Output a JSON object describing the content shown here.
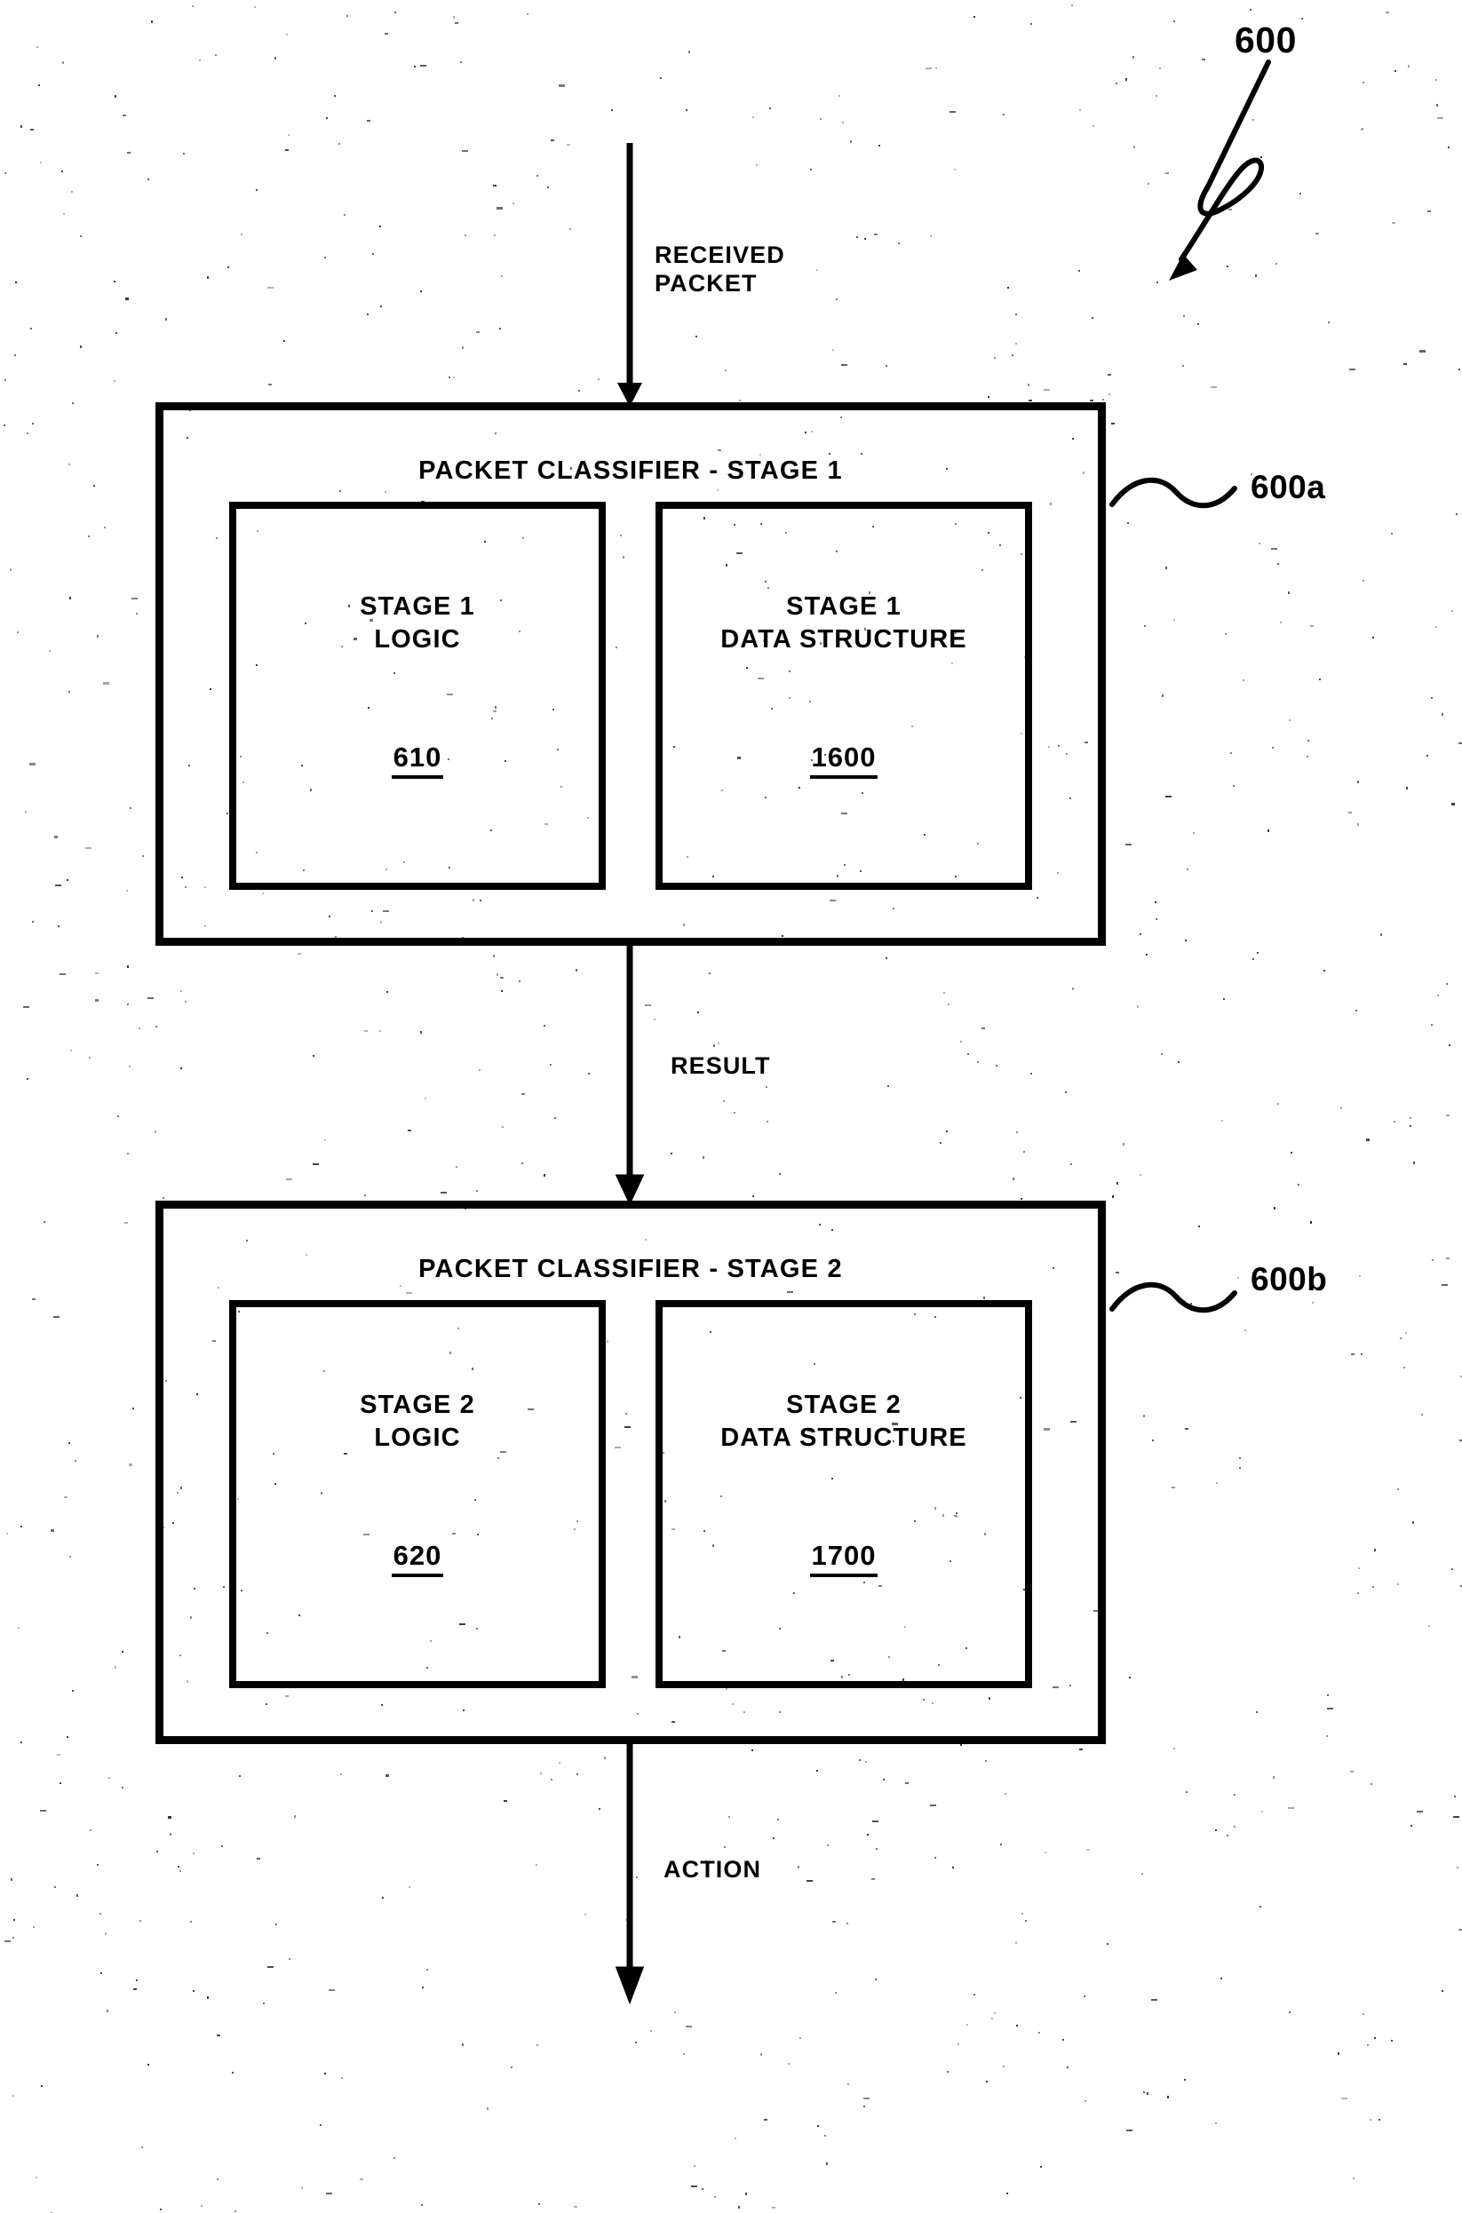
{
  "figure": {
    "reference_numeral": "600"
  },
  "flow": {
    "input_label": "RECEIVED\nPACKET",
    "middle_label": "RESULT",
    "output_label": "ACTION"
  },
  "stages": [
    {
      "title": "PACKET CLASSIFIER - STAGE 1",
      "side_reference": "600a",
      "blocks": [
        {
          "title": "STAGE 1\nLOGIC",
          "reference": "610"
        },
        {
          "title": "STAGE 1\nDATA STRUCTURE",
          "reference": "1600"
        }
      ]
    },
    {
      "title": "PACKET CLASSIFIER - STAGE 2",
      "side_reference": "600b",
      "blocks": [
        {
          "title": "STAGE 2\nLOGIC",
          "reference": "620"
        },
        {
          "title": "STAGE 2\nDATA STRUCTURE",
          "reference": "1700"
        }
      ]
    }
  ],
  "colors": {
    "ink": "#000000",
    "paper": "#ffffff"
  }
}
